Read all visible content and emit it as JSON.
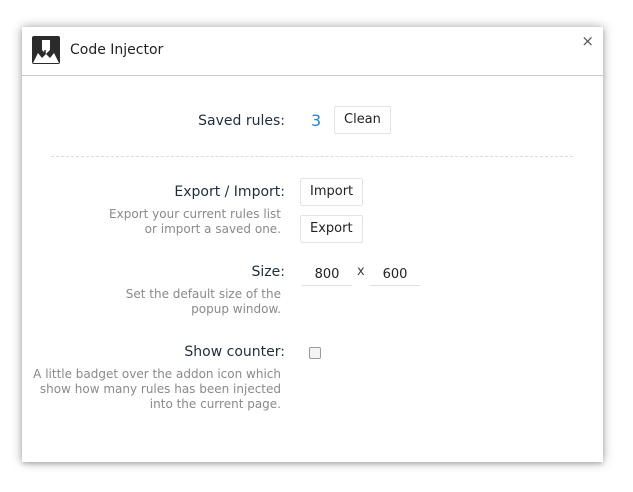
{
  "window": {
    "title": "Code Injector",
    "close_symbol": "×",
    "icon": "code-injector-logo-icon"
  },
  "saved_rules": {
    "label": "Saved rules:",
    "count": "3",
    "clean_label": "Clean"
  },
  "export_import": {
    "label": "Export / Import:",
    "help_line1": "Export your current rules list",
    "help_line2": "or import a saved one.",
    "import_label": "Import",
    "export_label": "Export"
  },
  "size": {
    "label": "Size:",
    "help_line1": "Set the default size of the",
    "help_line2": "popup window.",
    "width": "800",
    "separator": "x",
    "height": "600"
  },
  "show_counter": {
    "label": "Show counter:",
    "checked": false,
    "help_line1": "A little badget over the addon icon which",
    "help_line2": "show how many rules has been injected",
    "help_line3": "into the current page."
  },
  "colors": {
    "accent": "#1e88c8",
    "help_text": "#8a8a8a",
    "divider": "#dcdcdc"
  }
}
